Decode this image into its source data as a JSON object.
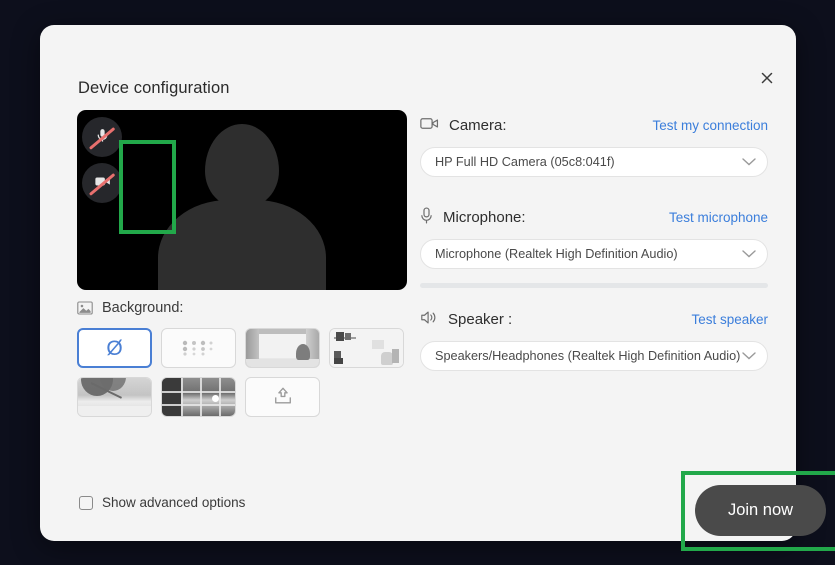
{
  "dialog": {
    "title": "Device configuration",
    "close_label": "close-icon"
  },
  "preview": {
    "mic_button_label": "microphone-muted",
    "camera_button_label": "camera-muted",
    "avatar_label": "user-silhouette"
  },
  "devices": {
    "camera": {
      "icon": "camera-icon",
      "label": "Camera:",
      "action": "Test my connection",
      "value": "HP Full HD Camera (05c8:041f)"
    },
    "microphone": {
      "icon": "microphone-icon",
      "label": "Microphone:",
      "action": "Test microphone",
      "value": "Microphone (Realtek High Definition Audio)"
    },
    "speaker": {
      "icon": "speaker-icon",
      "label": "Speaker :",
      "action": "Test speaker",
      "value": "Speakers/Headphones (Realtek High Definition Audio)"
    }
  },
  "background": {
    "icon": "image-icon",
    "label": "Background:",
    "options": [
      {
        "name": "none",
        "type": "none",
        "selected": true,
        "glyph": "Ø"
      },
      {
        "name": "blur",
        "type": "blur",
        "selected": false
      },
      {
        "name": "room",
        "type": "room",
        "selected": false
      },
      {
        "name": "office",
        "type": "office",
        "selected": false
      },
      {
        "name": "beach",
        "type": "beach",
        "selected": false
      },
      {
        "name": "bridge",
        "type": "bridge",
        "selected": false
      },
      {
        "name": "upload",
        "type": "upload",
        "selected": false
      }
    ]
  },
  "advanced": {
    "label": "Show advanced options",
    "checked": false
  },
  "join": {
    "label": "Join now"
  },
  "annotations": {
    "color": "#22a84a",
    "items": [
      "media-toggles-highlight",
      "join-now-highlight"
    ]
  }
}
